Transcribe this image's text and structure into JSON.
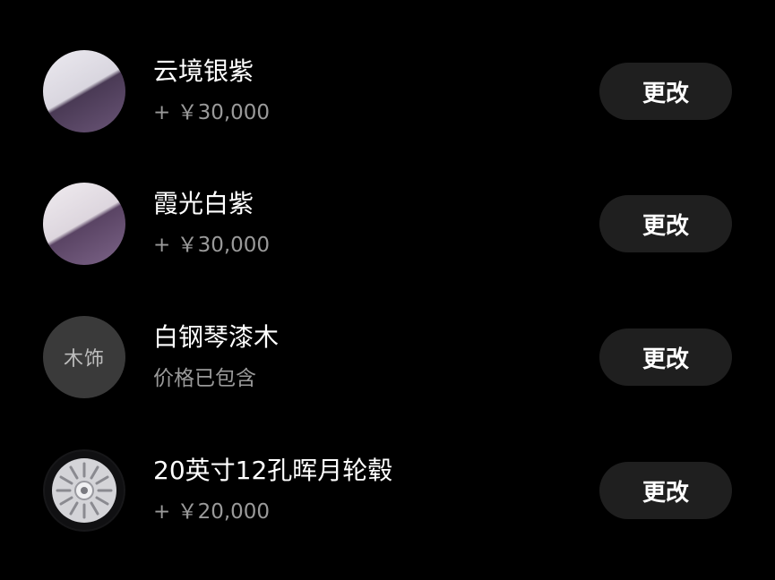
{
  "items": [
    {
      "title": "云境银紫",
      "price": "+ ￥30,000",
      "button": "更改",
      "thumb_color": "#5b4766"
    },
    {
      "title": "霞光白紫",
      "price": "+ ￥30,000",
      "button": "更改",
      "thumb_color": "#6e587b"
    },
    {
      "title": "白钢琴漆木",
      "price": "价格已包含",
      "button": "更改",
      "thumb_label": "木饰"
    },
    {
      "title": "20英寸12孔晖月轮毂",
      "price": "+ ￥20,000",
      "button": "更改"
    }
  ]
}
